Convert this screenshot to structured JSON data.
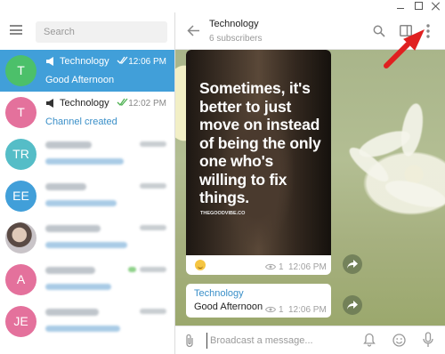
{
  "search": {
    "placeholder": "Search"
  },
  "chats": [
    {
      "name": "Technology",
      "time": "12:06 PM",
      "preview": "Good Afternoon",
      "avatar": "T",
      "avatar_color": "#4cc06a",
      "active": true,
      "channel": true
    },
    {
      "name": "Technology",
      "time": "12:02 PM",
      "preview": "Channel created",
      "avatar": "T",
      "avatar_color": "#e4719c",
      "active": false,
      "channel": true
    },
    {
      "avatar": "TR",
      "avatar_color": "#55bdc7",
      "blurred": true
    },
    {
      "avatar": "EE",
      "avatar_color": "#419fd9",
      "blurred": true
    },
    {
      "avatar": "",
      "avatar_color": "#cfcbd0",
      "blurred": true,
      "photo": true
    },
    {
      "avatar": "A",
      "avatar_color": "#e4719c",
      "blurred": true
    },
    {
      "avatar": "JE",
      "avatar_color": "#e4719c",
      "blurred": true
    }
  ],
  "header": {
    "title": "Technology",
    "subtitle": "6 subscribers"
  },
  "post": {
    "quote": "Sometimes, it's better to just move on instead of being the only one who's willing to fix things.",
    "source": "THEGOODVIBE.CO",
    "views": "1",
    "time": "12:06 PM"
  },
  "message": {
    "title": "Technology",
    "text": "Good Afternoon",
    "views": "1",
    "time": "12:06 PM"
  },
  "composer": {
    "placeholder": "Broadcast a message..."
  },
  "colors": {
    "accent": "#419fd9",
    "link": "#3a8fc8",
    "annotation": "#e02020"
  },
  "icons": [
    "menu-icon",
    "megaphone-icon",
    "double-check-icon",
    "back-arrow-icon",
    "search-icon",
    "panel-icon",
    "more-vertical-icon",
    "eye-icon",
    "forward-icon",
    "paperclip-icon",
    "bell-icon",
    "emoji-icon",
    "microphone-icon"
  ]
}
